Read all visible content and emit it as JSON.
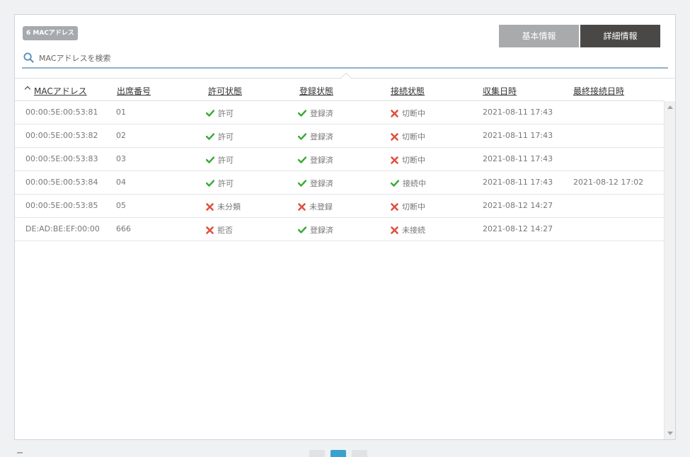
{
  "badge": {
    "label": "6 MACアドレス"
  },
  "view_toggle": {
    "basic": "基本情報",
    "detail": "詳細情報"
  },
  "search": {
    "placeholder": "MACアドレスを検索"
  },
  "columns": [
    "MACアドレス",
    "出席番号",
    "許可状態",
    "登録状態",
    "接続状態",
    "収集日時",
    "最終接続日時"
  ],
  "colors": {
    "ok": "#3aaa35",
    "ng": "#e0503f",
    "accent": "#3aa1cf"
  },
  "rows": [
    {
      "mac": "00:00:5E:00:53:81",
      "seat": "01",
      "permit": "許可",
      "permit_ok": true,
      "reg": "登録済",
      "reg_ok": true,
      "conn": "切断中",
      "conn_ok": false,
      "collected": "2021-08-11 17:43",
      "last": ""
    },
    {
      "mac": "00:00:5E:00:53:82",
      "seat": "02",
      "permit": "許可",
      "permit_ok": true,
      "reg": "登録済",
      "reg_ok": true,
      "conn": "切断中",
      "conn_ok": false,
      "collected": "2021-08-11 17:43",
      "last": ""
    },
    {
      "mac": "00:00:5E:00:53:83",
      "seat": "03",
      "permit": "許可",
      "permit_ok": true,
      "reg": "登録済",
      "reg_ok": true,
      "conn": "切断中",
      "conn_ok": false,
      "collected": "2021-08-11 17:43",
      "last": ""
    },
    {
      "mac": "00:00:5E:00:53:84",
      "seat": "04",
      "permit": "許可",
      "permit_ok": true,
      "reg": "登録済",
      "reg_ok": true,
      "conn": "接続中",
      "conn_ok": true,
      "collected": "2021-08-11 17:43",
      "last": "2021-08-12 17:02"
    },
    {
      "mac": "00:00:5E:00:53:85",
      "seat": "05",
      "permit": "未分類",
      "permit_ok": false,
      "reg": "未登録",
      "reg_ok": false,
      "conn": "切断中",
      "conn_ok": false,
      "collected": "2021-08-12 14:27",
      "last": ""
    },
    {
      "mac": "DE:AD:BE:EF:00:00",
      "seat": "666",
      "permit": "拒否",
      "permit_ok": false,
      "reg": "登録済",
      "reg_ok": true,
      "conn": "未接続",
      "conn_ok": false,
      "collected": "2021-08-12 14:27",
      "last": ""
    }
  ]
}
